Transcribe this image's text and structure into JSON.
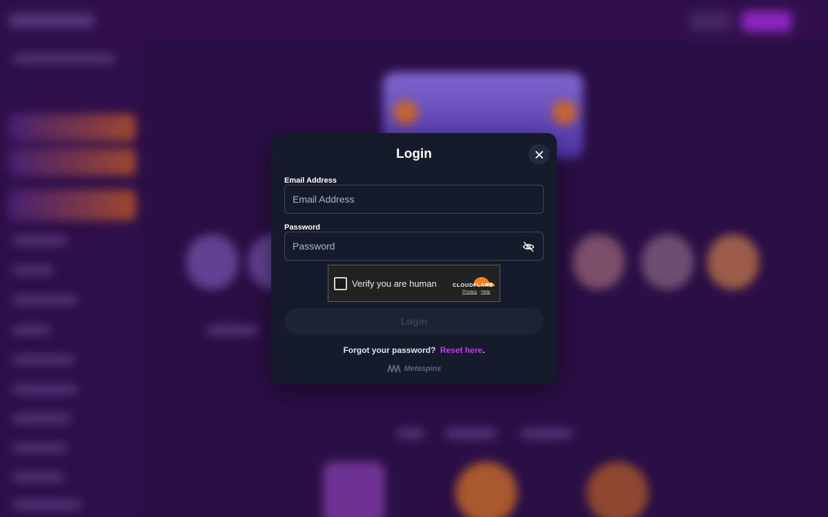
{
  "modal": {
    "title": "Login",
    "close_icon": "close-icon",
    "email": {
      "label": "Email Address",
      "placeholder": "Email Address",
      "value": ""
    },
    "password": {
      "label": "Password",
      "placeholder": "Password",
      "value": "",
      "toggle_icon": "eye-slash-icon"
    },
    "captcha": {
      "text": "Verify you are human",
      "brand": "CLOUDFLARE",
      "privacy_link": "Privacy",
      "separator": "·",
      "help_link": "Help"
    },
    "submit_label": "Login",
    "forgot_text": "Forgot your password?",
    "reset_link": "Reset here",
    "reset_period": ".",
    "powered_brand": "Metaspins"
  },
  "colors": {
    "modal_bg": "#161b2c",
    "accent": "#c13be8",
    "backdrop": "#2a0f45"
  }
}
